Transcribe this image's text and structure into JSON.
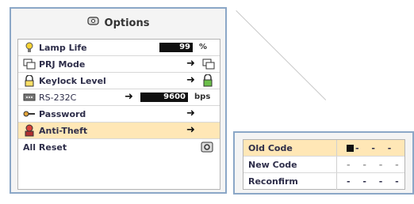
{
  "options": {
    "title": "Options",
    "items": [
      {
        "label": "Lamp Life",
        "value": "99",
        "unit": "%"
      },
      {
        "label": "PRJ Mode"
      },
      {
        "label": "Keylock Level"
      },
      {
        "label": "RS-232C",
        "value": "9600",
        "unit": "bps"
      },
      {
        "label": "Password"
      },
      {
        "label": "Anti-Theft"
      },
      {
        "label": "All Reset"
      }
    ]
  },
  "anti_theft": {
    "rows": [
      {
        "label": "Old Code",
        "code": "- - -"
      },
      {
        "label": "New Code",
        "code": "- - - -"
      },
      {
        "label": "Reconfirm",
        "code": "- - - -"
      }
    ]
  }
}
